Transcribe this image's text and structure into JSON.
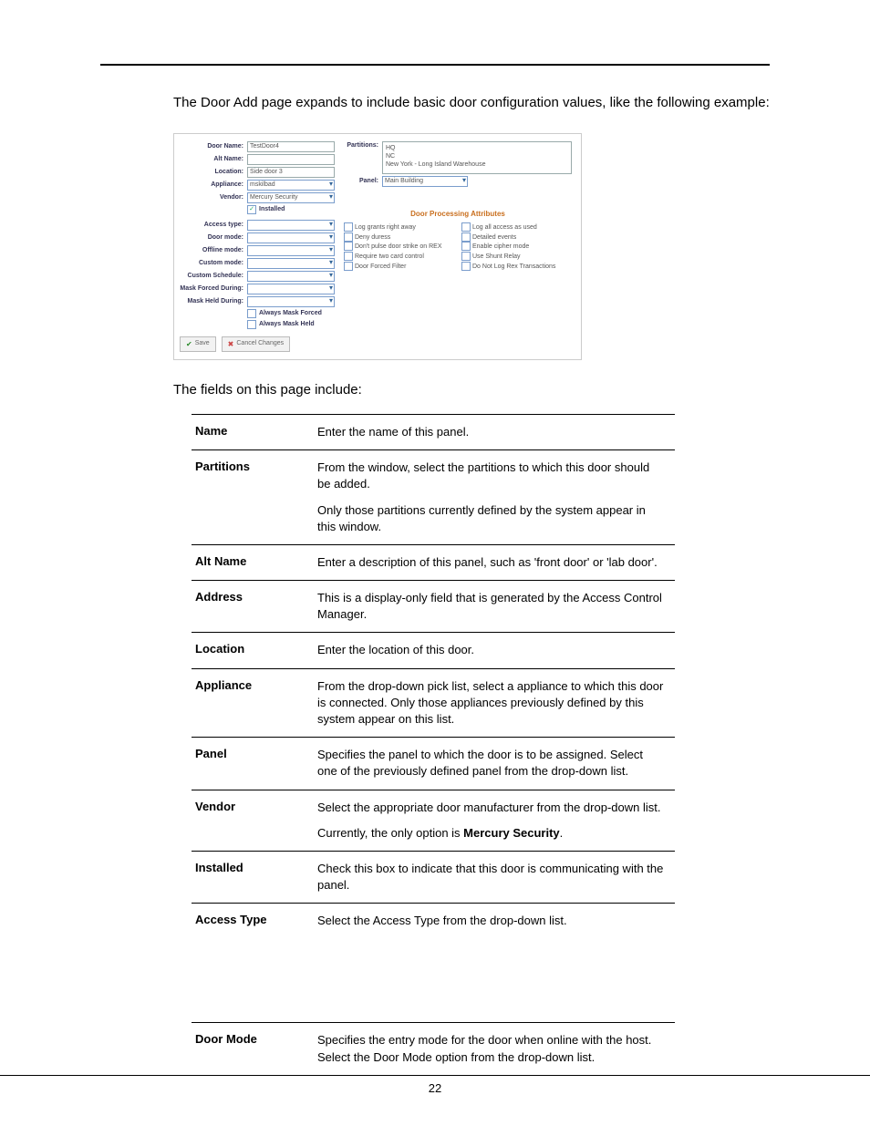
{
  "page_number": "22",
  "intro": "The Door Add page expands to include basic door configuration values, like the following example:",
  "sub_intro": "The fields on this page include:",
  "shot": {
    "labels": {
      "door_name": "Door Name:",
      "alt_name": "Alt Name:",
      "location": "Location:",
      "appliance": "Appliance:",
      "vendor": "Vendor:",
      "installed": "Installed",
      "access_type": "Access type:",
      "door_mode": "Door mode:",
      "offline_mode": "Offline mode:",
      "custom_mode": "Custom mode:",
      "custom_schedule": "Custom Schedule:",
      "mask_forced_during": "Mask Forced During:",
      "mask_held_during": "Mask Held During:",
      "always_mask_forced": "Always Mask Forced",
      "always_mask_held": "Always Mask Held",
      "partitions": "Partitions:",
      "panel": "Panel:"
    },
    "values": {
      "door_name": "TestDoor4",
      "location": "Side door 3",
      "appliance": "mskilbad",
      "vendor": "Mercury Security",
      "panel": "Main Building"
    },
    "partitions_list": [
      "HQ",
      "NC",
      "New York - Long Island Warehouse"
    ],
    "dpa_title": "Door Processing Attributes",
    "dpa_left": [
      "Log grants right away",
      "Deny duress",
      "Don't pulse door strike on REX",
      "Require two card control",
      "Door Forced Filter"
    ],
    "dpa_right": [
      "Log all access as used",
      "Detailed events",
      "Enable cipher mode",
      "Use Shunt Relay",
      "Do Not Log Rex Transactions"
    ],
    "buttons": {
      "save": "Save",
      "cancel": "Cancel Changes"
    }
  },
  "table": [
    {
      "name": "Name",
      "desc": [
        "Enter the name of this panel."
      ]
    },
    {
      "name": "Partitions",
      "desc": [
        "From the window, select the partitions to which this door should be added.",
        "Only those partitions currently defined by the system appear in this window."
      ]
    },
    {
      "name": "Alt Name",
      "desc": [
        "Enter a description of this panel, such as 'front door' or 'lab door'."
      ]
    },
    {
      "name": "Address",
      "desc": [
        "This is a display-only field that is generated by the Access Control Manager."
      ]
    },
    {
      "name": "Location",
      "desc": [
        "Enter the location of this door."
      ]
    },
    {
      "name": "Appliance",
      "desc": [
        "From the drop-down pick list, select a appliance to which this door is connected.  Only those appliances previously defined by this system appear on this list."
      ]
    },
    {
      "name": "Panel",
      "desc": [
        "Specifies the panel to which the door is to be assigned. Select one of the previously defined panel from the drop-down list."
      ]
    },
    {
      "name": "Vendor",
      "desc": [
        "Select the appropriate door manufacturer from the drop-down list.",
        "Currently, the only option is <b>Mercury Security</b>."
      ]
    },
    {
      "name": "Installed",
      "desc": [
        "Check this box to indicate that this door is communicating with the panel."
      ]
    },
    {
      "name": "Access Type",
      "desc": [
        "Select the Access Type from the drop-down list."
      ],
      "tall": true
    },
    {
      "name": "Door Mode",
      "desc": [
        "Specifies the entry mode for the door when online with the host. Select the Door Mode option from the drop-down list."
      ]
    }
  ]
}
